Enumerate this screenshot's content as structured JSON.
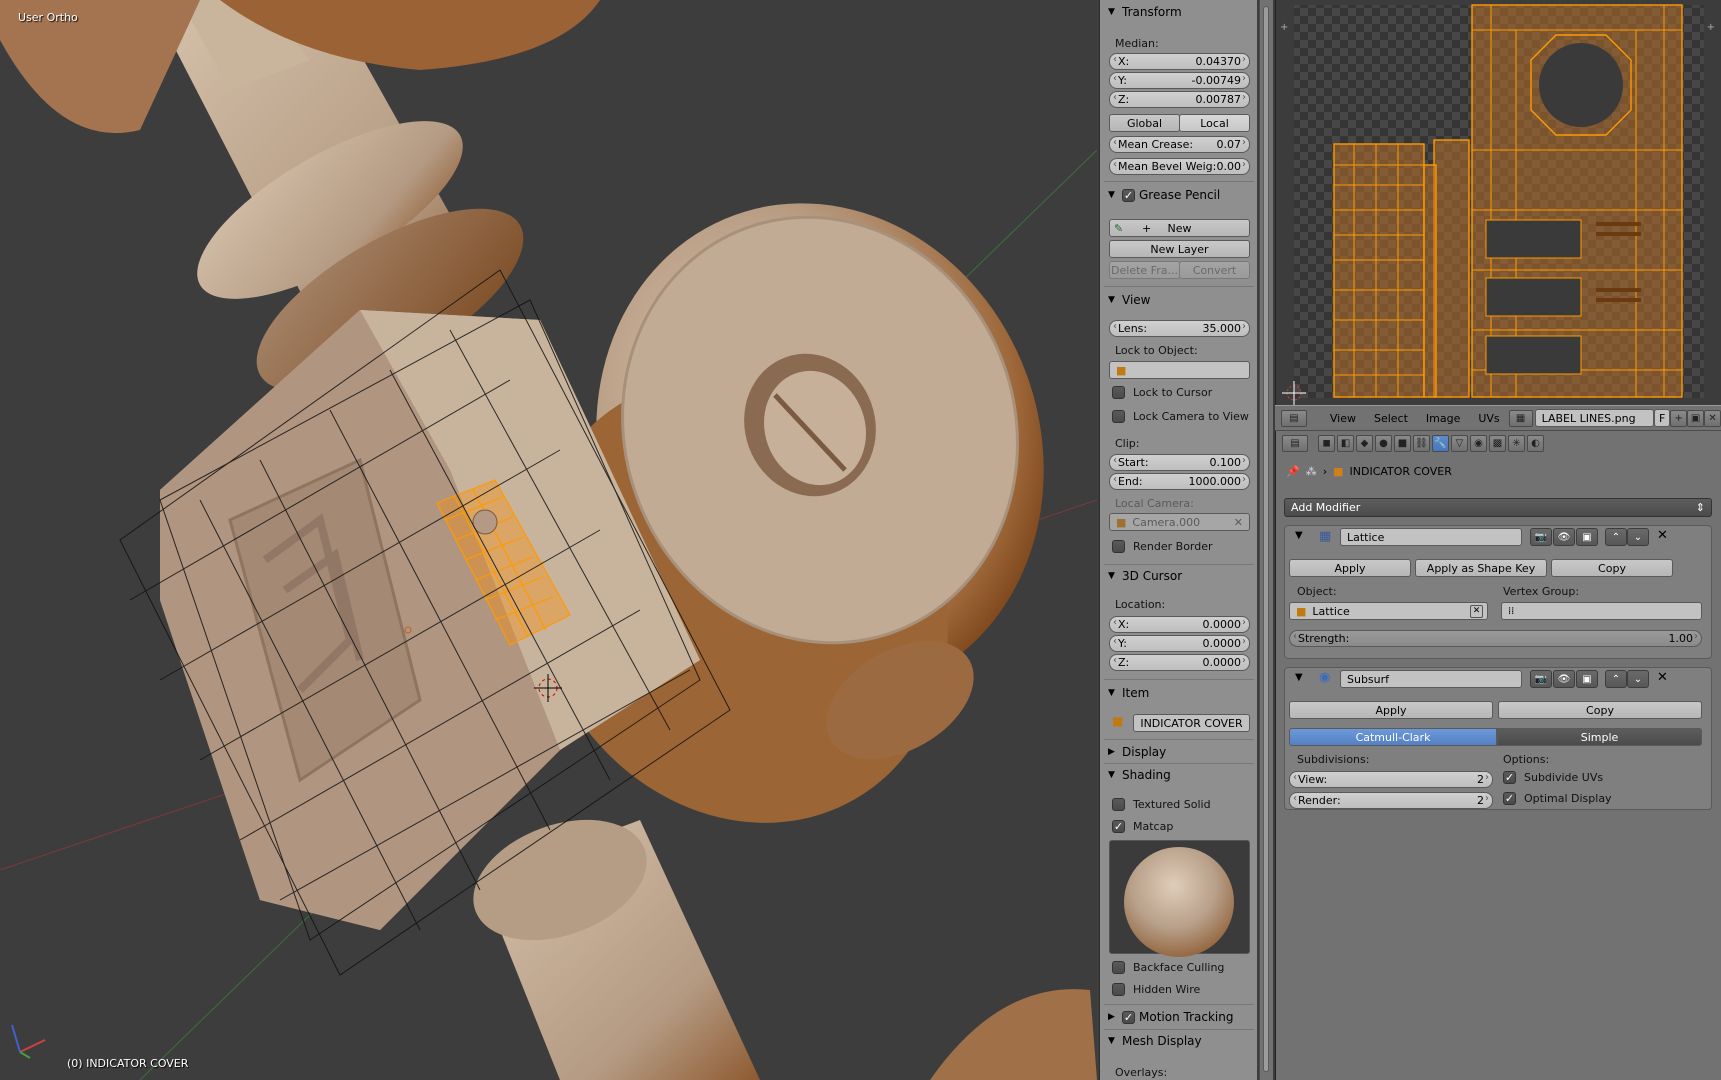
{
  "viewport": {
    "view_label": "User Ortho",
    "object_label": "(0) INDICATOR COVER"
  },
  "npanel": {
    "transform": {
      "title": "Transform",
      "median_label": "Median:",
      "x_label": "X:",
      "x_value": "0.04370",
      "y_label": "Y:",
      "y_value": "-0.00749",
      "z_label": "Z:",
      "z_value": "0.00787",
      "global_label": "Global",
      "local_label": "Local",
      "crease_label": "Mean Crease:",
      "crease_value": "0.07",
      "bevel_label": "Mean Bevel Weig:",
      "bevel_value": "0.00"
    },
    "grease_pencil": {
      "title": "Grease Pencil",
      "new_label": "New",
      "new_layer_label": "New Layer",
      "delete_frame_label": "Delete Fra...",
      "convert_label": "Convert"
    },
    "view": {
      "title": "View",
      "lens_label": "Lens:",
      "lens_value": "35.000",
      "lock_object_label": "Lock to Object:",
      "lock_cursor_label": "Lock to Cursor",
      "lock_camera_label": "Lock Camera to View",
      "clip_label": "Clip:",
      "start_label": "Start:",
      "start_value": "0.100",
      "end_label": "End:",
      "end_value": "1000.000",
      "local_camera_label": "Local Camera:",
      "camera_value": "Camera.000",
      "render_border_label": "Render Border"
    },
    "cursor": {
      "title": "3D Cursor",
      "location_label": "Location:",
      "x_label": "X:",
      "x_value": "0.0000",
      "y_label": "Y:",
      "y_value": "0.0000",
      "z_label": "Z:",
      "z_value": "0.0000"
    },
    "item": {
      "title": "Item",
      "name_value": "INDICATOR COVER"
    },
    "display": {
      "title": "Display"
    },
    "shading": {
      "title": "Shading",
      "textured_solid_label": "Textured Solid",
      "matcap_label": "Matcap",
      "backface_label": "Backface Culling",
      "hidden_wire_label": "Hidden Wire"
    },
    "motion_tracking": {
      "title": "Motion Tracking"
    },
    "mesh_display": {
      "title": "Mesh Display",
      "overlays_label": "Overlays:"
    }
  },
  "uv_header": {
    "menus": [
      "View",
      "Select",
      "Image",
      "UVs"
    ],
    "image_name": "LABEL LINES.png",
    "fake_user": "F"
  },
  "properties": {
    "object_name": "INDICATOR COVER",
    "add_modifier_label": "Add Modifier",
    "lattice": {
      "name": "Lattice",
      "apply_label": "Apply",
      "apply_shape_label": "Apply as Shape Key",
      "copy_label": "Copy",
      "object_label": "Object:",
      "object_value": "Lattice",
      "vertex_group_label": "Vertex Group:",
      "strength_label": "Strength:",
      "strength_value": "1.00"
    },
    "subsurf": {
      "name": "Subsurf",
      "apply_label": "Apply",
      "copy_label": "Copy",
      "catmull_label": "Catmull-Clark",
      "simple_label": "Simple",
      "subdivisions_label": "Subdivisions:",
      "options_label": "Options:",
      "view_label": "View:",
      "view_value": "2",
      "render_label": "Render:",
      "render_value": "2",
      "subdivide_uvs_label": "Subdivide UVs",
      "optimal_display_label": "Optimal Display"
    }
  }
}
